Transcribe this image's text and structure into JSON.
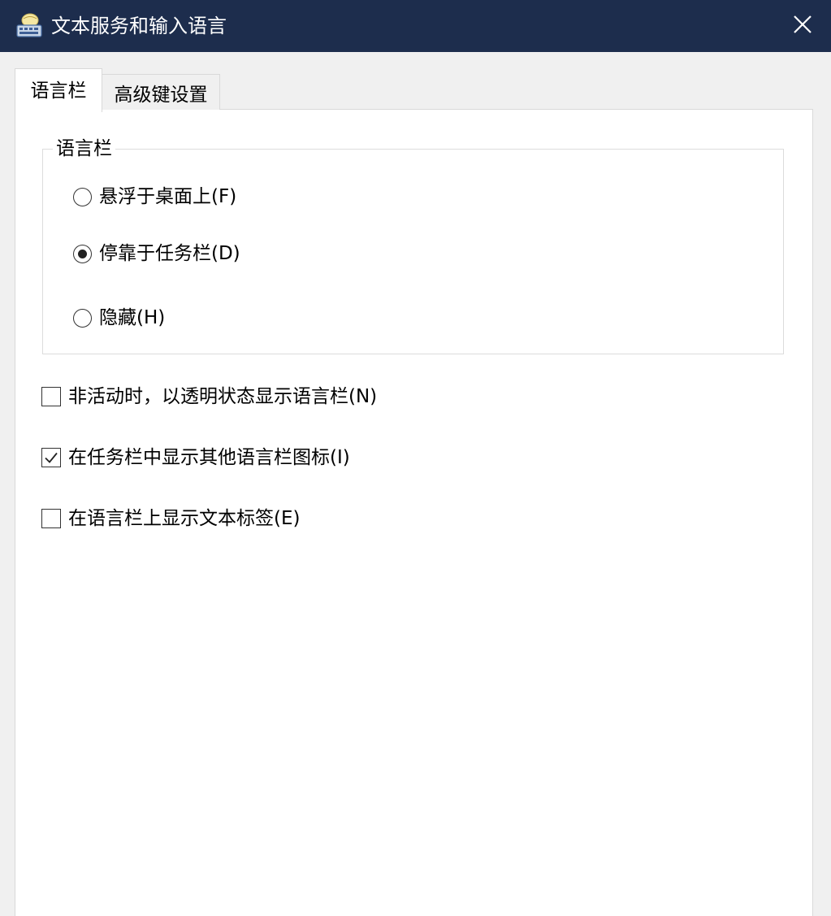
{
  "window": {
    "title": "文本服务和输入语言",
    "icon": "keyboard-globe-icon",
    "close_icon": "close-icon",
    "titlebar_color": "#1d2d4d"
  },
  "tabs": [
    {
      "label": "语言栏",
      "active": true
    },
    {
      "label": "高级键设置",
      "active": false
    }
  ],
  "language_bar_group": {
    "title": "语言栏",
    "options": [
      {
        "label": "悬浮于桌面上(F)",
        "checked": false
      },
      {
        "label": "停靠于任务栏(D)",
        "checked": true
      },
      {
        "label": "隐藏(H)",
        "checked": false
      }
    ]
  },
  "checkboxes": [
    {
      "label": "非活动时，以透明状态显示语言栏(N)",
      "checked": false
    },
    {
      "label": "在任务栏中显示其他语言栏图标(I)",
      "checked": true
    },
    {
      "label": "在语言栏上显示文本标签(E)",
      "checked": false
    }
  ]
}
